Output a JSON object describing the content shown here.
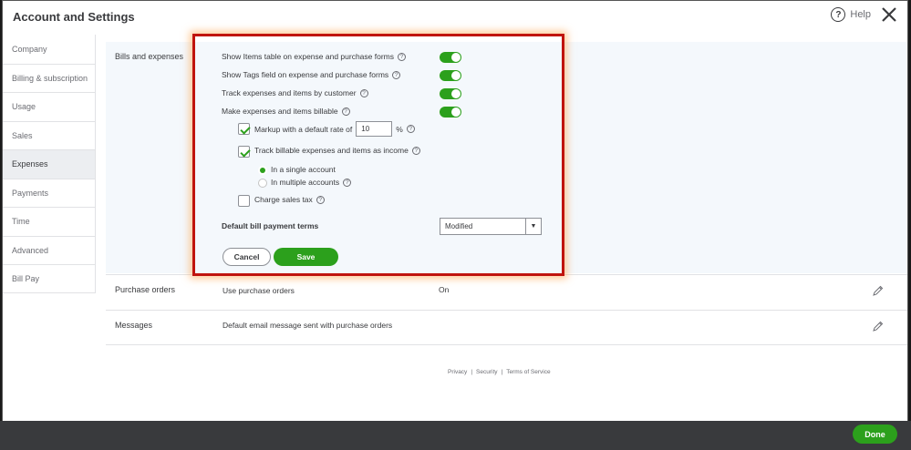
{
  "header": {
    "title": "Account and Settings",
    "help_label": "Help"
  },
  "sidebar": {
    "items": [
      {
        "label": "Company"
      },
      {
        "label": "Billing & subscription"
      },
      {
        "label": "Usage"
      },
      {
        "label": "Sales"
      },
      {
        "label": "Expenses",
        "active": true
      },
      {
        "label": "Payments"
      },
      {
        "label": "Time"
      },
      {
        "label": "Advanced"
      },
      {
        "label": "Bill Pay"
      }
    ]
  },
  "bills": {
    "section_label": "Bills and expenses",
    "show_items_table": {
      "label": "Show Items table on expense and purchase forms",
      "enabled": true
    },
    "show_tags": {
      "label": "Show Tags field on expense and purchase forms",
      "enabled": true
    },
    "track_by_customer": {
      "label": "Track expenses and items by customer",
      "enabled": true
    },
    "make_billable": {
      "label": "Make expenses and items billable",
      "enabled": true
    },
    "markup": {
      "label": "Markup with a default rate of",
      "checked": true,
      "value": "10",
      "unit": "%"
    },
    "track_income": {
      "label": "Track billable expenses and items as income",
      "checked": true
    },
    "single_account": {
      "label": "In a single account",
      "selected": true
    },
    "multiple_accounts": {
      "label": "In multiple accounts",
      "selected": false
    },
    "charge_tax": {
      "label": "Charge sales tax",
      "checked": false
    },
    "payment_terms": {
      "label": "Default bill payment terms",
      "value": "Modified"
    },
    "cancel_label": "Cancel",
    "save_label": "Save"
  },
  "purchase_orders": {
    "section_label": "Purchase orders",
    "description": "Use purchase orders",
    "value": "On"
  },
  "messages": {
    "section_label": "Messages",
    "description": "Default email message sent with purchase orders"
  },
  "footer": {
    "privacy": "Privacy",
    "sep": "|",
    "security": "Security",
    "terms": "Terms of Service"
  },
  "done_label": "Done",
  "colors": {
    "accent": "#2ca01c",
    "highlight": "#c0140e",
    "bottom_bar": "#393a3d"
  }
}
